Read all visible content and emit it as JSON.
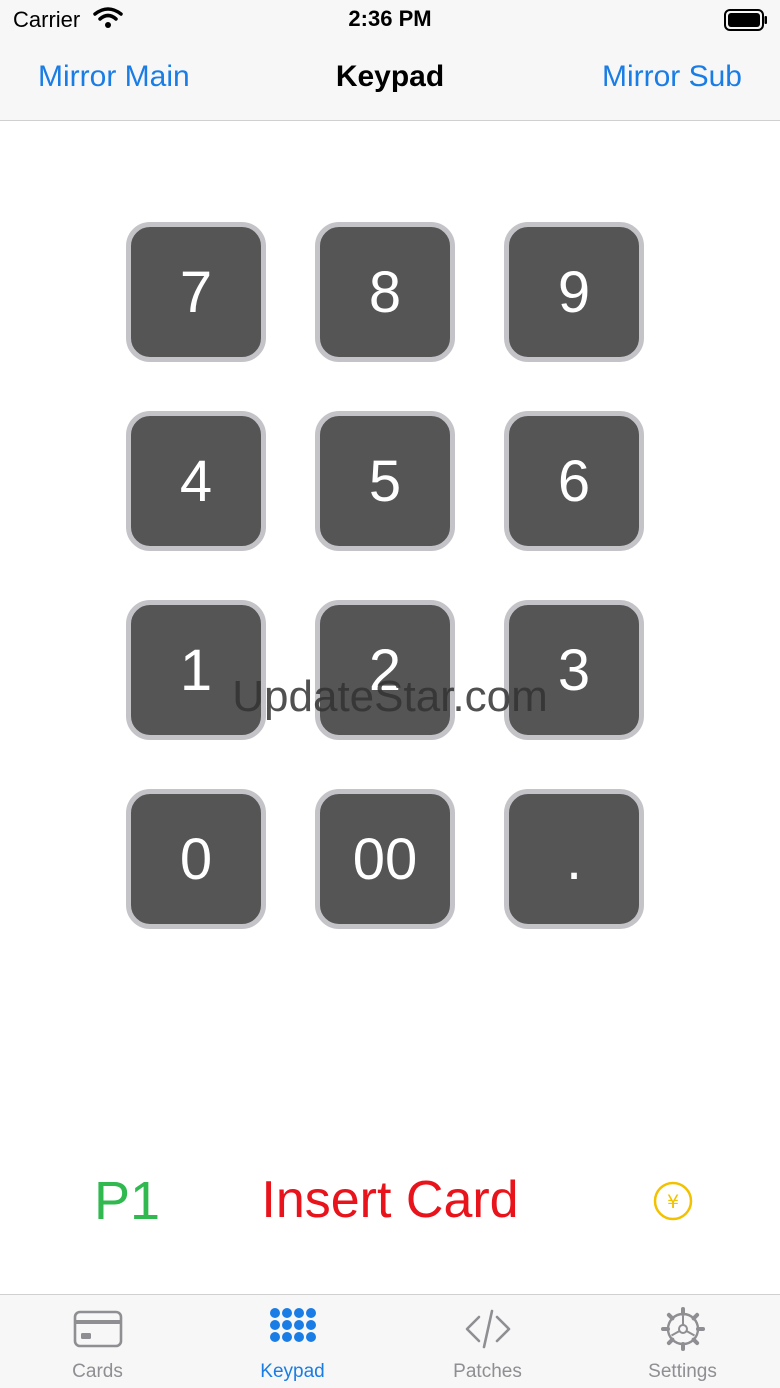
{
  "status_bar": {
    "carrier": "Carrier",
    "time": "2:36 PM"
  },
  "nav": {
    "left": "Mirror Main",
    "title": "Keypad",
    "right": "Mirror Sub"
  },
  "keypad": {
    "keys": [
      "7",
      "8",
      "9",
      "4",
      "5",
      "6",
      "1",
      "2",
      "3",
      "0",
      "00",
      "."
    ]
  },
  "watermark": "UpdateStar.com",
  "footer": {
    "player": "P1",
    "message": "Insert Card",
    "currency_icon": "yen-coin-icon"
  },
  "tabs": [
    {
      "label": "Cards",
      "icon": "card-icon"
    },
    {
      "label": "Keypad",
      "icon": "keypad-grid-icon"
    },
    {
      "label": "Patches",
      "icon": "code-icon"
    },
    {
      "label": "Settings",
      "icon": "gear-icon"
    }
  ],
  "colors": {
    "accent": "#1a7de5",
    "inactive_tab": "#8e8e93",
    "player": "#2fb94f",
    "message": "#e8131b",
    "coin": "#f2c200",
    "key_fill": "#555555",
    "key_border": "#c4c4c8"
  },
  "selected_tab": "Keypad"
}
